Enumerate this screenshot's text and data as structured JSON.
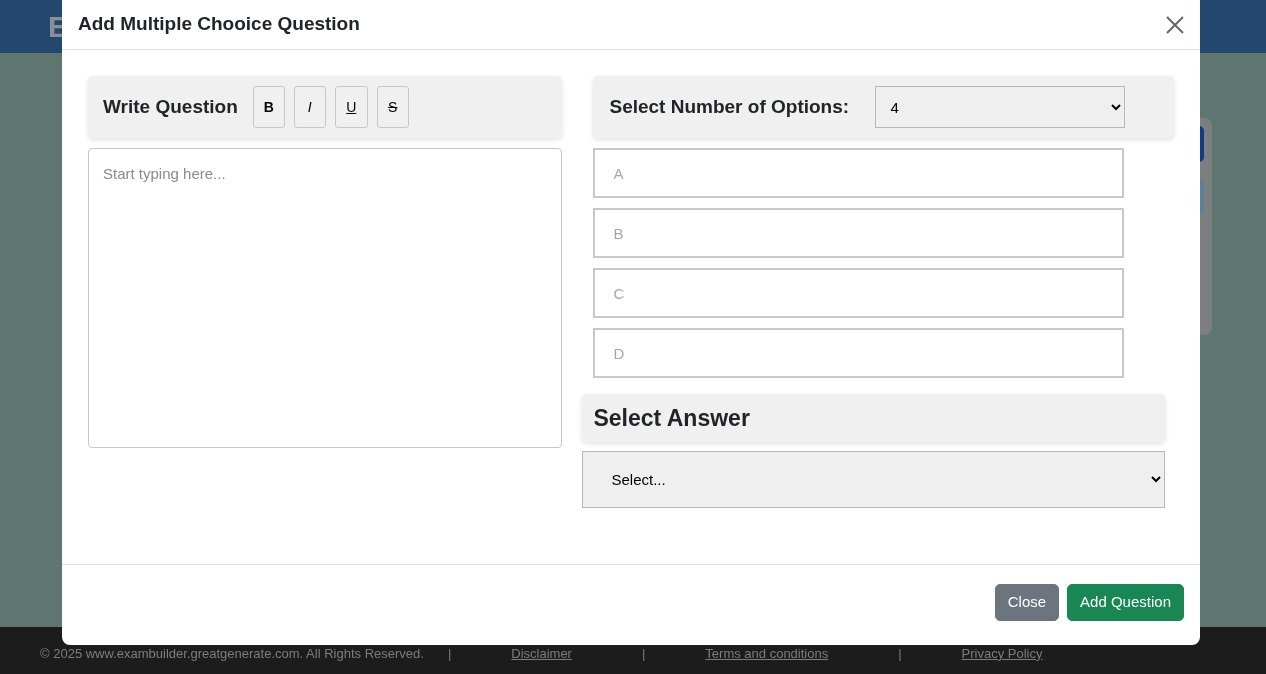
{
  "page": {
    "header_text": "E",
    "footer": {
      "copyright": "© 2025 www.exambuilder.greatgenerate.com. All Rights Reserved.",
      "separators": [
        "|",
        "|",
        "|"
      ],
      "links": [
        "Disclaimer",
        "Terms and conditions",
        "Privacy Policy"
      ]
    }
  },
  "modal": {
    "title": "Add Multiple Chooice Question",
    "question": {
      "heading": "Write Question",
      "format_buttons": [
        {
          "label": "B",
          "kind": "bold"
        },
        {
          "label": "I",
          "kind": "italic"
        },
        {
          "label": "U",
          "kind": "underline"
        },
        {
          "label": "S",
          "kind": "strike"
        }
      ],
      "placeholder": "Start typing here..."
    },
    "options": {
      "label": "Select Number of Options:",
      "count": "4",
      "fields": [
        {
          "placeholder": "A"
        },
        {
          "placeholder": "B"
        },
        {
          "placeholder": "C"
        },
        {
          "placeholder": "D"
        }
      ]
    },
    "answer": {
      "heading": "Select Answer",
      "value": "Select..."
    },
    "buttons": [
      {
        "label": "Close",
        "kind": "secondary"
      },
      {
        "label": "Add Question",
        "kind": "success"
      }
    ]
  }
}
